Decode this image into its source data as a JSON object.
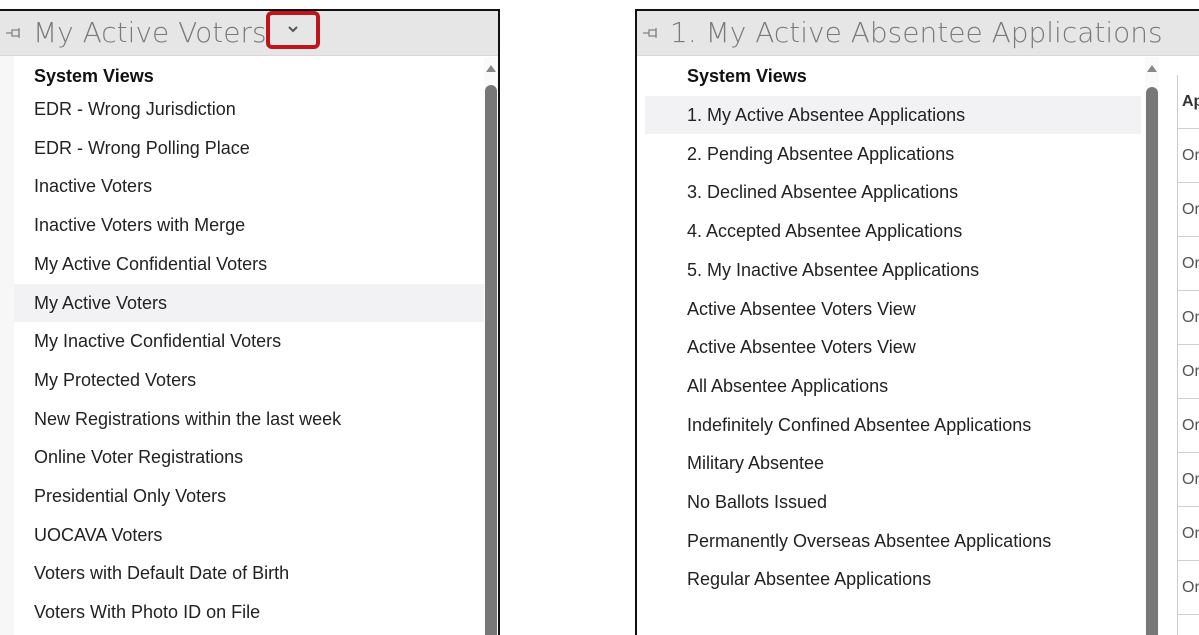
{
  "left_panel": {
    "title": "My Active Voters",
    "section_header": "System Views",
    "items": [
      {
        "label": "EDR - Wrong Jurisdiction"
      },
      {
        "label": "EDR - Wrong Polling Place"
      },
      {
        "label": "Inactive Voters"
      },
      {
        "label": "Inactive Voters with Merge"
      },
      {
        "label": "My Active Confidential Voters"
      },
      {
        "label": "My Active Voters",
        "selected": true
      },
      {
        "label": "My Inactive Confidential Voters"
      },
      {
        "label": "My Protected Voters"
      },
      {
        "label": "New Registrations within the last week"
      },
      {
        "label": "Online Voter Registrations"
      },
      {
        "label": "Presidential Only Voters"
      },
      {
        "label": "UOCAVA Voters"
      },
      {
        "label": "Voters with Default Date of Birth"
      },
      {
        "label": "Voters With Photo ID on File"
      }
    ]
  },
  "right_panel": {
    "title": "1. My Active Absentee Applications",
    "section_header": "System Views",
    "items": [
      {
        "label": "1. My Active Absentee Applications",
        "selected": true
      },
      {
        "label": "2. Pending Absentee Applications"
      },
      {
        "label": "3. Declined Absentee Applications"
      },
      {
        "label": "4. Accepted Absentee Applications"
      },
      {
        "label": "5. My Inactive Absentee Applications"
      },
      {
        "label": "Active Absentee Voters View"
      },
      {
        "label": "Active Absentee Voters View"
      },
      {
        "label": "All Absentee Applications"
      },
      {
        "label": "Indefinitely Confined Absentee Applications"
      },
      {
        "label": "Military Absentee"
      },
      {
        "label": "No Ballots Issued"
      },
      {
        "label": "Permanently Overseas Absentee Applications"
      },
      {
        "label": "Regular Absentee Applications"
      }
    ],
    "grid_header": "Ap",
    "grid_cells": [
      "Or",
      "Or",
      "Or",
      "Or",
      "Or",
      "Or",
      "Or",
      "Or",
      "Or"
    ]
  },
  "colors": {
    "highlight_border": "#c0141b",
    "header_bg": "#e6e6e6"
  },
  "icons": [
    "pin-icon",
    "chevron-down-icon"
  ]
}
